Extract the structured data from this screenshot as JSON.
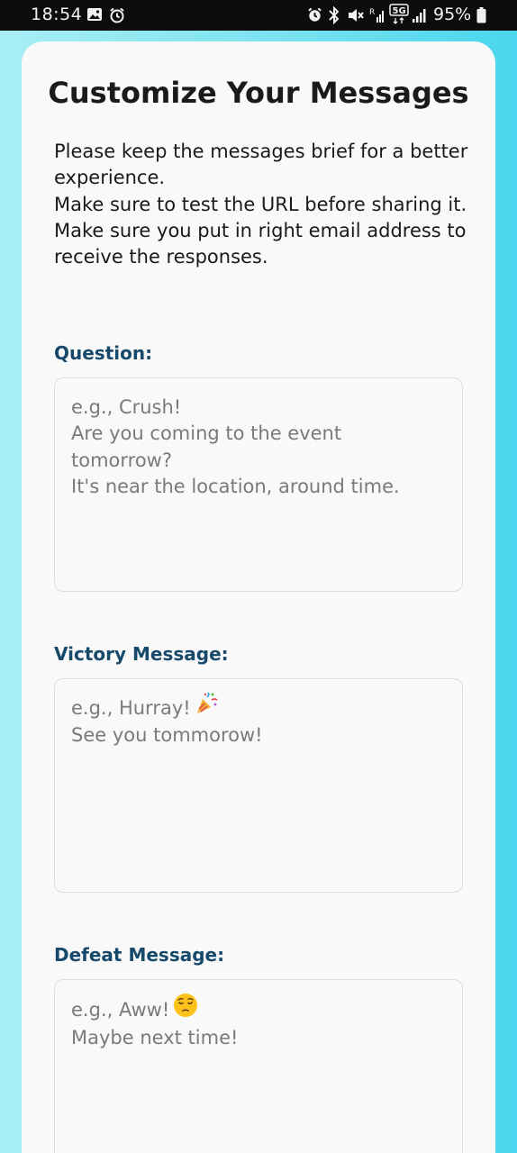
{
  "status_bar": {
    "time": "18:54",
    "battery_percent": "95%",
    "network": "5G"
  },
  "page": {
    "title": "Customize Your Messages",
    "intro_lines": [
      "Please keep the messages brief for a better experience.",
      "Make sure to test the URL before sharing it.",
      "Make sure you put in right email address to receive the responses."
    ]
  },
  "fields": {
    "question": {
      "label": "Question:",
      "value": "",
      "placeholder_lines": [
        "e.g., Crush!",
        "Are you coming to the event tomorrow?",
        "It's near the location, around time."
      ]
    },
    "victory": {
      "label": "Victory Message:",
      "value": "",
      "placeholder_lines": [
        "e.g., Hurray!",
        "See you tommorow!"
      ],
      "emoji": "party-popper-icon"
    },
    "defeat": {
      "label": "Defeat Message:",
      "value": "",
      "placeholder_lines": [
        "e.g., Aww!",
        "Maybe next time!"
      ],
      "emoji": "pensive-face-icon"
    }
  },
  "colors": {
    "label": "#17496b",
    "placeholder": "#7a7a7a",
    "background_gradient_start": "#a9eef5",
    "background_gradient_end": "#49d6ee"
  }
}
